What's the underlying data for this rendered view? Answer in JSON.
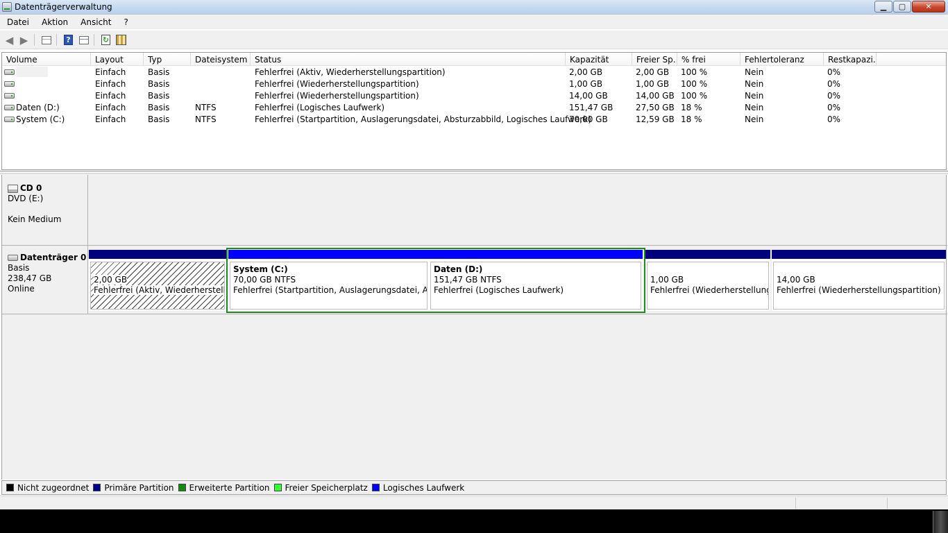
{
  "window": {
    "title": "Datenträgerverwaltung",
    "controls": {
      "minimize": "▁",
      "maximize": "▢",
      "close": "✕"
    }
  },
  "menu": [
    "Datei",
    "Aktion",
    "Ansicht",
    "?"
  ],
  "toolbar": {
    "icons": [
      "back-arrow-icon",
      "forward-arrow-icon",
      "view-icon",
      "help-icon",
      "properties-icon",
      "refresh-icon",
      "settings-icon"
    ],
    "help_glyph": "?",
    "refresh_glyph": "↻"
  },
  "list": {
    "columns": [
      "Volume",
      "Layout",
      "Typ",
      "Dateisystem",
      "Status",
      "Kapazität",
      "Freier Sp...",
      "% frei",
      "Fehlertoleranz",
      "Restkapazi..."
    ],
    "rows": [
      [
        "",
        "Einfach",
        "Basis",
        "",
        "Fehlerfrei (Aktiv, Wiederherstellungspartition)",
        "2,00 GB",
        "2,00 GB",
        "100 %",
        "Nein",
        "0%"
      ],
      [
        "",
        "Einfach",
        "Basis",
        "",
        "Fehlerfrei (Wiederherstellungspartition)",
        "1,00 GB",
        "1,00 GB",
        "100 %",
        "Nein",
        "0%"
      ],
      [
        "",
        "Einfach",
        "Basis",
        "",
        "Fehlerfrei (Wiederherstellungspartition)",
        "14,00 GB",
        "14,00 GB",
        "100 %",
        "Nein",
        "0%"
      ],
      [
        "Daten (D:)",
        "Einfach",
        "Basis",
        "NTFS",
        "Fehlerfrei (Logisches Laufwerk)",
        "151,47 GB",
        "27,50 GB",
        "18 %",
        "Nein",
        "0%"
      ],
      [
        "System (C:)",
        "Einfach",
        "Basis",
        "NTFS",
        "Fehlerfrei (Startpartition, Auslagerungsdatei, Absturzabbild, Logisches Laufwerk)",
        "70,00 GB",
        "12,59 GB",
        "18 %",
        "Nein",
        "0%"
      ]
    ]
  },
  "disks": {
    "cd0": {
      "name": "CD 0",
      "line1": "DVD (E:)",
      "line2": "Kein Medium"
    },
    "disk0": {
      "name": "Datenträger 0",
      "type": "Basis",
      "size": "238,47 GB",
      "state": "Online",
      "partitions": [
        {
          "name": "",
          "size": "2,00 GB",
          "status": "Fehlerfrei (Aktiv, Wiederherstellungspartition)"
        },
        {
          "name": "System  (C:)",
          "size": "70,00 GB NTFS",
          "status": "Fehlerfrei (Startpartition, Auslagerungsdatei, Absturzabbild, Logisches Laufwerk)"
        },
        {
          "name": "Daten  (D:)",
          "size": "151,47 GB NTFS",
          "status": "Fehlerfrei (Logisches Laufwerk)"
        },
        {
          "name": "",
          "size": "1,00 GB",
          "status": "Fehlerfrei (Wiederherstellungspartition)"
        },
        {
          "name": "",
          "size": "14,00 GB",
          "status": "Fehlerfrei (Wiederherstellungspartition)"
        }
      ]
    }
  },
  "legend": [
    {
      "label": "Nicht zugeordnet",
      "color": "#000000"
    },
    {
      "label": "Primäre Partition",
      "color": "#00008b"
    },
    {
      "label": "Erweiterte Partition",
      "color": "#128a12"
    },
    {
      "label": "Freier Speicherplatz",
      "color": "#33ff33"
    },
    {
      "label": "Logisches Laufwerk",
      "color": "#0000ff"
    }
  ],
  "colors": {
    "primary_bar": "#00007f",
    "logical_bar": "#0000ff",
    "extended_border": "#1c8a1c"
  }
}
